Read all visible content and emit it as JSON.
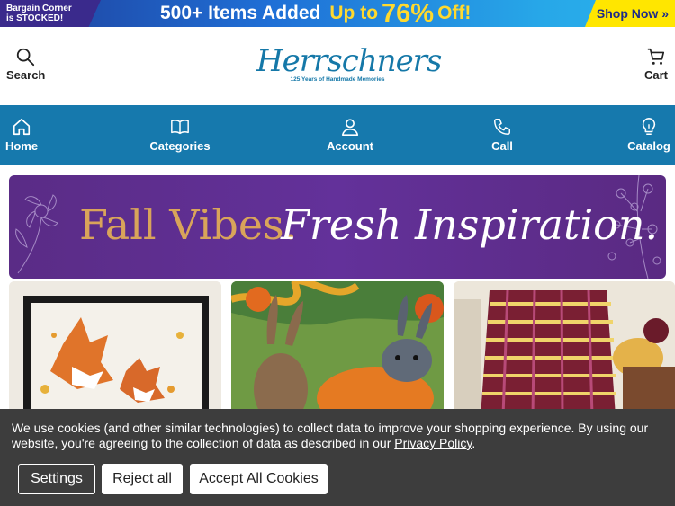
{
  "promo": {
    "left_line1": "Bargain Corner",
    "left_line2": "is STOCKED!",
    "headline": "500+ Items Added",
    "upto": "Up to",
    "percent": "76%",
    "off": "Off!",
    "cta": "Shop Now »"
  },
  "header": {
    "search_label": "Search",
    "cart_label": "Cart",
    "logo_name": "Herrschners",
    "logo_tag": "125 Years of Handmade Memories"
  },
  "nav": {
    "items": [
      {
        "label": "Home",
        "icon": "home-icon"
      },
      {
        "label": "Categories",
        "icon": "book-icon"
      },
      {
        "label": "Account",
        "icon": "user-icon"
      },
      {
        "label": "Call",
        "icon": "phone-icon"
      },
      {
        "label": "Catalog",
        "icon": "lightbulb-icon"
      }
    ]
  },
  "banner": {
    "part1": "Fall Vibes.",
    "part2": "Fresh Inspiration."
  },
  "cookie": {
    "message_before": "We use cookies (and other similar technologies) to collect data to improve your shopping experience. By using our website, you're agreeing to the collection of data as described in our ",
    "policy_link": "Privacy Policy",
    "message_after": ".",
    "settings_label": "Settings",
    "reject_label": "Reject all",
    "accept_label": "Accept All Cookies"
  },
  "colors": {
    "nav_bg": "#1679ad",
    "banner_purple": "#5a2c86",
    "promo_yellow": "#ffd92e",
    "cookie_bg": "#3d3d3d"
  }
}
